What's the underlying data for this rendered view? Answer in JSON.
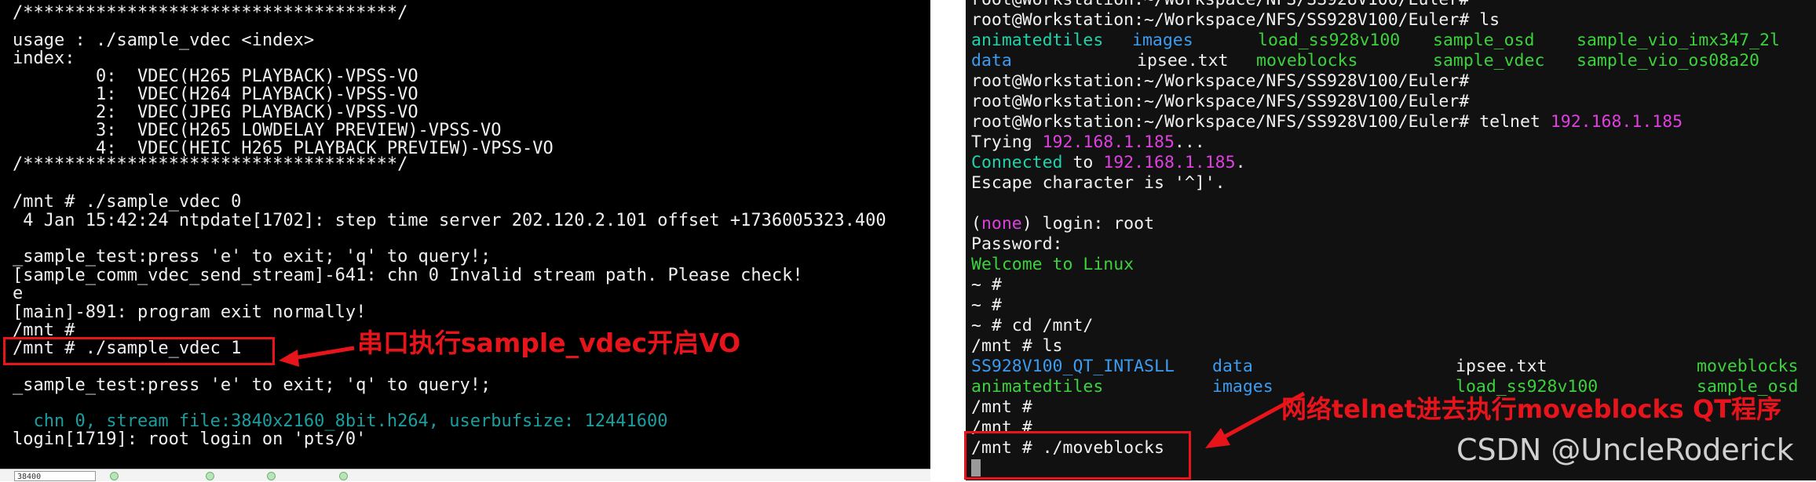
{
  "left_terminal": {
    "lines": [
      "/************************************/",
      "usage : ./sample_vdec <index>",
      "index:",
      "        0:  VDEC(H265 PLAYBACK)-VPSS-VO",
      "        1:  VDEC(H264 PLAYBACK)-VPSS-VO",
      "        2:  VDEC(JPEG PLAYBACK)-VPSS-VO",
      "        3:  VDEC(H265 LOWDELAY PREVIEW)-VPSS-VO",
      "        4:  VDEC(HEIC H265 PLAYBACK PREVIEW)-VPSS-VO",
      "/************************************/",
      "",
      "/mnt # ./sample_vdec 0",
      " 4 Jan 15:42:24 ntpdate[1702]: step time server 202.120.2.101 offset +1736005323.400",
      "",
      "_sample_test:press 'e' to exit; 'q' to query!;",
      "[sample_comm_vdec_send_stream]-641: chn 0 Invalid stream path. Please check!",
      "e",
      "[main]-891: program exit normally!",
      "/mnt #",
      "/mnt # ./sample_vdec 1",
      "",
      "_sample_test:press 'e' to exit; 'q' to query!;",
      "",
      "  chn 0, stream file:3840x2160_8bit.h264, userbufsize: 12441600",
      "login[1719]: root login on 'pts/0'"
    ],
    "cyan_color": "#1a9e9e"
  },
  "status_bar": {
    "field_value": "38400"
  },
  "right_terminal": {
    "top_partial": "root@Workstation:~/Workspace/NFS/SS928V100/Euler#",
    "prompt": "root@Workstation:~/Workspace/NFS/SS928V100/Euler#",
    "cmd_ls": " ls",
    "ls_row1": [
      "animatedtiles",
      "images",
      "load_ss928v100",
      "sample_osd",
      "sample_vio_imx347_2l"
    ],
    "ls_row2": [
      "data",
      "ipsee.txt",
      "moveblocks",
      "sample_vdec",
      "sample_vio_os08a20"
    ],
    "cmd_telnet": " telnet ",
    "ip": "192.168.1.185",
    "trying_prefix": "Trying ",
    "trying_suffix": "...",
    "connected_word": "Connected",
    "connected_to": " to ",
    "connected_suffix": ".",
    "escape_line": "Escape character is '^]'.",
    "none_word": "none",
    "login_paren_open": "(",
    "login_rest": ") login: root",
    "password_line": "Password:",
    "welcome_line": "Welcome to Linux",
    "tilde1": "~ #",
    "tilde2": "~ #",
    "cd_line": "~ # cd /mnt/",
    "mnt_ls": "/mnt # ls",
    "mnt_row1": [
      "SS928V100_QT_INTASLL",
      "data",
      "ipsee.txt",
      "moveblocks"
    ],
    "mnt_row2": [
      "animatedtiles",
      "images",
      "load_ss928v100",
      "sample_osd"
    ],
    "mnt_p1": "/mnt #",
    "mnt_p2": "/mnt #",
    "mnt_run": "/mnt # ./moveblocks",
    "colors": {
      "dir": "#1fd3ab",
      "file": "#e6e6e6",
      "ip": "#e040e0",
      "exec": "#3cd23c",
      "text": "#f0f0f0"
    }
  },
  "annotations": {
    "left_label": "串口执行sample_vdec开启VO",
    "right_label": "网络telnet进去执行moveblocks QT程序",
    "color": "#e8141b"
  },
  "watermark": "CSDN @UncleRoderick"
}
